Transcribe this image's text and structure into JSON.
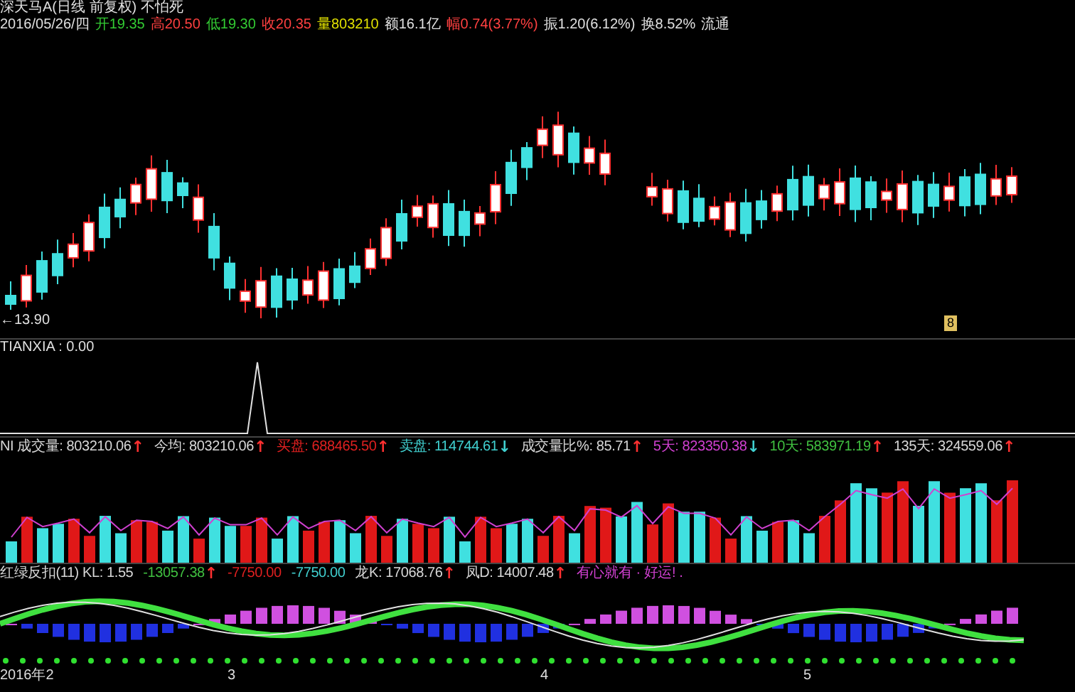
{
  "header": {
    "title": "深天马A(日线 前复权) 不怕死",
    "quote": [
      {
        "label": "2016/05/26/四",
        "color": "#e0e0e0"
      },
      {
        "label": "开",
        "value": "19.35",
        "color": "#33cc33"
      },
      {
        "label": "高",
        "value": "20.50",
        "color": "#ff4040"
      },
      {
        "label": "低",
        "value": "19.30",
        "color": "#33cc33"
      },
      {
        "label": "收",
        "value": "20.35",
        "color": "#ff4040"
      },
      {
        "label": "量",
        "value": "803210",
        "color": "#e0e000"
      },
      {
        "label": "额",
        "value": "16.1亿",
        "color": "#e0e0e0"
      },
      {
        "label": "幅",
        "value": "0.74(3.77%)",
        "color": "#ff4040"
      },
      {
        "label": "振",
        "value": "1.20(6.12%)",
        "color": "#e0e0e0"
      },
      {
        "label": "换",
        "value": "8.52%",
        "color": "#e0e0e0"
      },
      {
        "label": "流通",
        "color": "#e0e0e0"
      }
    ]
  },
  "price_panel": {
    "low_label": "←13.90",
    "marker": "8"
  },
  "tianxia_panel": {
    "legend": "TIANXIA : 0.00"
  },
  "volume_panel": {
    "legend": [
      {
        "label": "NI 成交量:",
        "value": "803210.06",
        "arrow": {
          "symbol": "↑",
          "color": "#ff3030"
        },
        "color": "#d8d8d8"
      },
      {
        "label": "今均:",
        "value": "803210.06",
        "arrow": {
          "symbol": "↑",
          "color": "#ff3030"
        },
        "color": "#d8d8d8"
      },
      {
        "label": "买盘:",
        "value": "688465.50",
        "arrow": {
          "symbol": "↑",
          "color": "#ff3030"
        },
        "color": "#e02020"
      },
      {
        "label": "卖盘:",
        "value": "114744.61",
        "arrow": {
          "symbol": "↓",
          "color": "#40d0d0"
        },
        "color": "#40d0d0"
      },
      {
        "label": "成交量比%:",
        "value": "85.71",
        "arrow": {
          "symbol": "↑",
          "color": "#ff3030"
        },
        "color": "#d8d8d8"
      },
      {
        "label": "5天:",
        "value": "823350.38",
        "arrow": {
          "symbol": "↓",
          "color": "#40d0d0"
        },
        "color": "#d040d0"
      },
      {
        "label": "10天:",
        "value": "583971.19",
        "arrow": {
          "symbol": "↑",
          "color": "#ff3030"
        },
        "color": "#40c040"
      },
      {
        "label": "135天:",
        "value": "324559.06",
        "arrow": {
          "symbol": "↑",
          "color": "#ff3030"
        },
        "color": "#d8d8d8"
      }
    ]
  },
  "indicator_panel": {
    "legend": [
      {
        "label": "红绿反扣(11) KL:",
        "value": "1.55",
        "color": "#d8d8d8"
      },
      {
        "value": "-13057.38",
        "arrow": {
          "symbol": "↑",
          "color": "#ff3030"
        },
        "color": "#40c040"
      },
      {
        "value": "-7750.00",
        "color": "#e02020"
      },
      {
        "value": "-7750.00",
        "color": "#40d0d0"
      },
      {
        "label": "龙K:",
        "value": "17068.76",
        "arrow": {
          "symbol": "↑",
          "color": "#ff3030"
        },
        "color": "#d8d8d8"
      },
      {
        "label": "凤D:",
        "value": "14007.48",
        "arrow": {
          "symbol": "↑",
          "color": "#ff3030"
        },
        "color": "#d8d8d8"
      },
      {
        "label": "有心就有 · 好运!",
        "value": ".",
        "color": "#d040d0"
      }
    ]
  },
  "date_axis": [
    "2016年2",
    "3",
    "4",
    "5"
  ]
}
